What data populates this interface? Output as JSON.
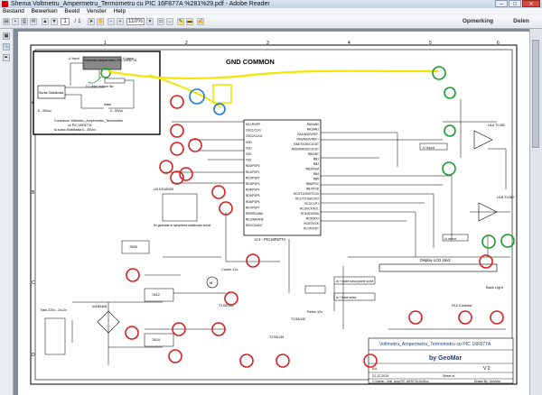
{
  "window": {
    "title": "Shema Voltmetru_Ampermetru_Termometru cu PIC 16F877A %281%29.pdf - Adobe Reader"
  },
  "menu": {
    "items": [
      "Bestand",
      "Bewerken",
      "Beeld",
      "Venster",
      "Help"
    ]
  },
  "toolbar": {
    "page_current": "1",
    "page_total": "/ 1",
    "zoom": "110%",
    "comment_label": "Opmerking",
    "share_label": "Delen"
  },
  "schematic": {
    "gnd_common_label": "GND COMMON",
    "inset_caption_1": "Conexiune Voltmetru_Ampermetru_Termometru",
    "inset_caption_2": "cu PIC 16F877A",
    "inset_caption_3": "la sursa Stabilizata 0...30Vcc",
    "inset_box_title": "Voltmetru Ampermetru PIC 16F877A",
    "inset_u_input_left": "U Input",
    "inset_u_input_right": "U Input",
    "inset_sursa": "Sursa Stabilizata",
    "inset_range": "0...30Vcc",
    "inset_shunt": "0.1 ohmi rezistor 5w",
    "inset_iesire": "Iesire",
    "inset_bottom": "0...30Vcc",
    "chip_label": "U 2 - PIC16F877A",
    "ic_ds18s20": "U3 DS18S20",
    "senzor_note": "Se gaseaste in apropierea radiatorului sursei",
    "cooler": "Cooler 12v",
    "relay": "Releu 12v",
    "la_mode": "la + mode sursa putere surse",
    "la_minus": "la + iesire surse",
    "lcd_label": "Display LCD 16x2",
    "back_light": "Back Light",
    "contrast": "R12 Contrast",
    "trafo": "Trafo 220v - 2x12v",
    "bridge": "4x1N5408",
    "u_input_1": "U Input",
    "u_input_2": "U input",
    "u1a": "U1A TL082",
    "u1b": "U1B TL082",
    "t1": "T1 BD135",
    "t2": "T2 BD135",
    "t3": "T3 BD135",
    "ic7805": "7805",
    "ic7812": "7812",
    "ic7824": "7824",
    "footer_title": "Voltmetru_Ampermetru_Termometru cu PIC 16F877A",
    "footer_by": "by GeoMar",
    "footer_size": "A4",
    "footer_rev": "V 2",
    "footer_date": "22.12.2015",
    "footer_sheet": "Sheet of",
    "footer_file": "C:\\Users\\...\\Volt_Amp PIC 16F877A.SchDoc",
    "footer_drawn": "Drawn By: GeoMar",
    "gnd": "GND",
    "pin_labels_left": [
      "MCLR/VPP",
      "OSC1/CLKI",
      "OSC2/CLKO",
      "VDD",
      "VDD",
      "VSS",
      "VSS",
      "RD0/PSP0",
      "RD1/PSP1",
      "RD2/PSP2",
      "RD3/PSP3",
      "RD4/PSP4",
      "RD5/PSP5",
      "RD6/PSP6",
      "RD7/PSP7",
      "RE0/RD/AN5",
      "RE1/WR/AN6",
      "RE2/CS/AN7"
    ],
    "pin_labels_right": [
      "RA0/AN0",
      "RA1/AN1",
      "RA2/AN2/VREF-",
      "RA3/AN3/VREF+",
      "RA4/T0CKI/C1OUT",
      "RA5/AN4/SS/C2OUT",
      "RB0/INT",
      "RB1",
      "RB2",
      "RB3/PGM",
      "RB4",
      "RB5",
      "RB6/PGC",
      "RB7/PGD",
      "RC0/T1OSO/T1CKI",
      "RC1/T1OSI/CCP2",
      "RC2/CCP1",
      "RC3/SCK/SCL",
      "RC4/SDI/SDA",
      "RC5/SDO",
      "RC6/TX/CK",
      "RC7/RX/DT"
    ],
    "border_numbers": [
      "1",
      "2",
      "3",
      "4",
      "5",
      "6"
    ],
    "border_letters": [
      "A",
      "B",
      "C",
      "D"
    ]
  },
  "colors": {
    "highlight_red": "#d42020",
    "highlight_green": "#1a9a2a",
    "highlight_blue": "#1e78d0",
    "highlight_yellow": "#f2e500"
  }
}
